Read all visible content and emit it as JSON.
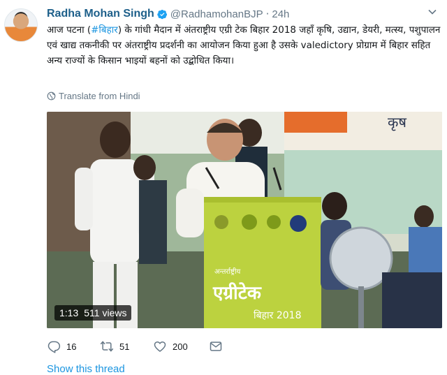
{
  "tweet": {
    "author_name": "Radha Mohan Singh",
    "handle": "@RadhamohanBJP",
    "separator": "·",
    "timestamp": "24h",
    "text_before_hashtag": "आज पटना (",
    "hashtag": "#बिहार",
    "text_after_hashtag": ") के गांधी मैदान में अंतराष्ट्रीय एग्री टेक बिहार 2018 जहाँ कृषि, उद्यान, डेयरी, मत्स्य, पशुपालन एवं खाद्य तकनीकी पर अंतराष्ट्रीय प्रदर्शनी का आयोजन किया हुआ है उसके valedictory प्रोग्राम में बिहार सहित अन्य राज्यों के किसान भाइयों बहनों को उद्बोधित किया।",
    "translate_label": "Translate from Hindi"
  },
  "video": {
    "duration": "1:13",
    "views": "511 views",
    "banner_top": "कृष",
    "podium_small": "अन्तर्राष्ट्रीय",
    "podium_main": "एग्रीटेक",
    "podium_sub": "बिहार 2018"
  },
  "actions": {
    "reply_count": "16",
    "retweet_count": "51",
    "like_count": "200"
  },
  "show_thread_label": "Show this thread",
  "colors": {
    "name": "#1d5f8a",
    "link": "#1b95e0",
    "secondary": "#657786",
    "verified": "#1da1f2"
  }
}
